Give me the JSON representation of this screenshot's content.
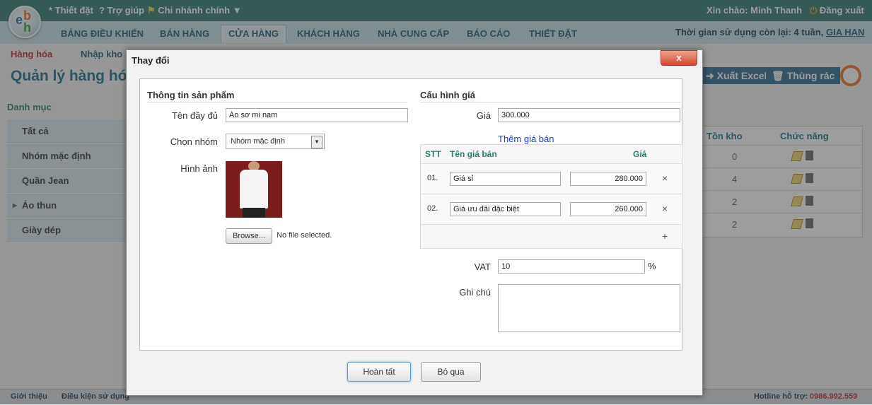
{
  "topbar": {
    "settings": "* Thiết đặt",
    "help": "? Trợ giúp",
    "branch": "Chi nhánh chính",
    "greeting": "Xin chào: Minh Thanh",
    "logout": "Đăng xuất"
  },
  "nav": {
    "tabs": [
      "BẢNG ĐIỀU KHIỂN",
      "BÁN HÀNG",
      "CỬA HÀNG",
      "KHÁCH HÀNG",
      "NHÀ CUNG CẤP",
      "BÁO CÁO",
      "THIẾT ĐẶT"
    ],
    "usage": "Thời gian sử dụng còn lại: 4 tuần,",
    "renew": "GIA HẠN"
  },
  "page": {
    "subnav": [
      "Hàng hóa",
      "Nhập kho"
    ],
    "title": "Quản lý hàng hóa",
    "export": "Xuất Excel",
    "trash": "Thùng rác"
  },
  "sidebar": {
    "heading": "Danh mục",
    "items": [
      "Tất cả",
      "Nhóm mặc định",
      "Quần Jean",
      "Áo thun",
      "Giày dép"
    ]
  },
  "rtable": {
    "col_stock": "Tồn kho",
    "col_actions": "Chức năng",
    "stock": [
      "0",
      "4",
      "2",
      "2"
    ]
  },
  "dialog": {
    "title": "Thay đổi",
    "close": "x",
    "product_section": "Thông tin sản phẩm",
    "price_section": "Cấu hình giá",
    "fullname_label": "Tên đầy đủ",
    "fullname_value": "Áo sơ mi nam",
    "group_label": "Chọn nhóm",
    "group_value": "Nhóm mặc định",
    "image_label": "Hình ảnh",
    "browse": "Browse...",
    "no_file": "No file selected.",
    "price_label": "Giá",
    "price_value": "300.000",
    "add_price": "Thêm giá bán",
    "price_table": {
      "col_stt": "STT",
      "col_name": "Tên giá bán",
      "col_price": "Giá",
      "rows": [
        {
          "stt": "01.",
          "name": "Giá sỉ",
          "price": "280.000"
        },
        {
          "stt": "02.",
          "name": "Giá ưu đãi đặc biệt",
          "price": "260.000"
        }
      ],
      "add": "+"
    },
    "vat_label": "VAT",
    "vat_value": "10",
    "vat_unit": "%",
    "note_label": "Ghi chú",
    "note_value": "",
    "done": "Hoàn tất",
    "skip": "Bỏ qua"
  },
  "footer": {
    "intro": "Giới thiệu",
    "terms": "Điều kiện sử dụng",
    "hotline_label": "Hotline hỗ trợ:",
    "hotline": "0986.992.559"
  }
}
